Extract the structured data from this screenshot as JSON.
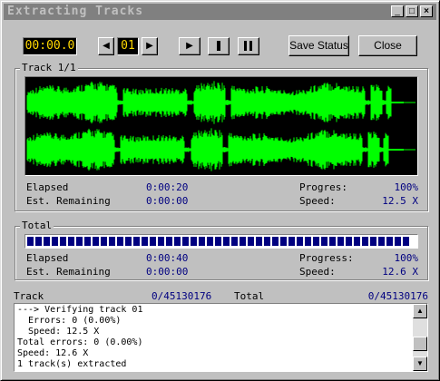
{
  "window": {
    "title": "Extracting Tracks"
  },
  "titlebar": {
    "minimize": "_",
    "maximize": "□",
    "close": "×"
  },
  "toolbar": {
    "time_display": "00:00.0",
    "prev_icon": "◀",
    "track_number": "01",
    "next_icon": "▶",
    "play_icon": "▶",
    "save_status_label": "Save Status",
    "close_label": "Close"
  },
  "track_group": {
    "title": "Track 1/1",
    "elapsed_label": "Elapsed",
    "elapsed_value": "0:00:20",
    "remaining_label": "Est. Remaining",
    "remaining_value": "0:00:00",
    "progress_label": "Progres:",
    "progress_value": "100%",
    "speed_label": "Speed:",
    "speed_value": "12.5 X",
    "waveform_color": "#00ff00"
  },
  "total_group": {
    "title": "Total",
    "progress_fraction": 1.0,
    "bar_color": "#000080",
    "elapsed_label": "Elapsed",
    "elapsed_value": "0:00:40",
    "remaining_label": "Est. Remaining",
    "remaining_value": "0:00:00",
    "progress_label": "Progress:",
    "progress_value": "100%",
    "speed_label": "Speed:",
    "speed_value": "12.6 X"
  },
  "summary": {
    "track_label": "Track",
    "track_value": "0/45130176",
    "total_label": "Total",
    "total_value": "0/45130176"
  },
  "log": {
    "lines": [
      "---> Verifying track 01",
      "  Errors: 0 (0.00%)",
      "  Speed: 12.5 X",
      "Total errors: 0 (0.00%)",
      "Speed: 12.6 X",
      "1 track(s) extracted"
    ],
    "scroll_up_icon": "▲",
    "scroll_down_icon": "▼"
  }
}
